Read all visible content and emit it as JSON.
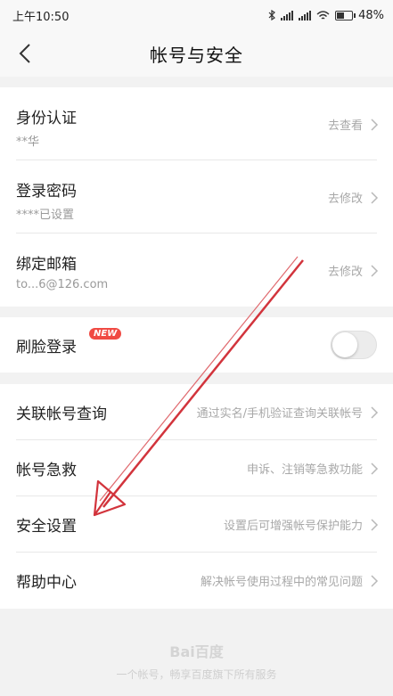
{
  "status_bar": {
    "time": "上午10:50",
    "battery": "48%"
  },
  "nav": {
    "title": "帐号与安全"
  },
  "account_rows": [
    {
      "title": "身份认证",
      "sub": "**华",
      "action": "去查看"
    },
    {
      "title": "登录密码",
      "sub": "****已设置",
      "action": "去修改"
    },
    {
      "title": "绑定邮箱",
      "sub": "to...6@126.com",
      "action": "去修改"
    }
  ],
  "face_login": {
    "title": "刷脸登录",
    "badge": "NEW",
    "enabled": false
  },
  "service_rows": [
    {
      "title": "关联帐号查询",
      "desc": "通过实名/手机验证查询关联帐号"
    },
    {
      "title": "帐号急救",
      "desc": "申诉、注销等急救功能"
    },
    {
      "title": "安全设置",
      "desc": "设置后可增强帐号保护能力"
    },
    {
      "title": "帮助中心",
      "desc": "解决帐号使用过程中的常见问题"
    }
  ],
  "footer": {
    "logo": "Bai百度",
    "tagline": "一个帐号，畅享百度旗下所有服务"
  },
  "colors": {
    "badge": "#f04a43",
    "annotation_arrow": "#d2343c"
  }
}
